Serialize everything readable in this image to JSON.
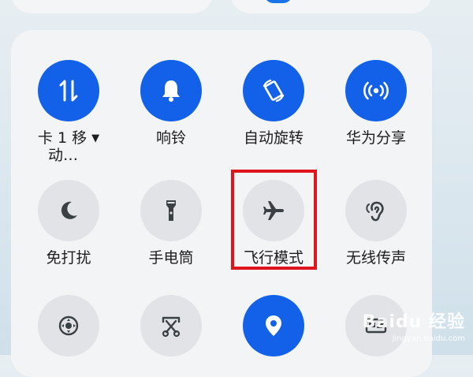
{
  "tiles": [
    {
      "id": "data",
      "label": "卡 1 移",
      "label2": "动…",
      "caret": "▼",
      "state": "on",
      "icon": "data-transfer-icon"
    },
    {
      "id": "ring",
      "label": "响铃",
      "state": "on",
      "icon": "bell-icon"
    },
    {
      "id": "rotate",
      "label": "自动旋转",
      "state": "on",
      "icon": "auto-rotate-icon"
    },
    {
      "id": "share",
      "label": "华为分享",
      "state": "on",
      "icon": "huawei-share-icon"
    },
    {
      "id": "dnd",
      "label": "免打扰",
      "state": "off",
      "icon": "moon-icon"
    },
    {
      "id": "flashlight",
      "label": "手电筒",
      "state": "off",
      "icon": "flashlight-icon"
    },
    {
      "id": "airplane",
      "label": "飞行模式",
      "state": "off",
      "icon": "airplane-icon"
    },
    {
      "id": "wireless-audio",
      "label": "无线传声",
      "state": "off",
      "icon": "ear-icon"
    },
    {
      "id": "floating-nav",
      "label": "",
      "state": "off",
      "icon": "navigation-dock-icon"
    },
    {
      "id": "screenshot",
      "label": "",
      "state": "off",
      "icon": "screenshot-scissors-icon"
    },
    {
      "id": "location",
      "label": "",
      "state": "on",
      "icon": "location-pin-icon"
    },
    {
      "id": "card",
      "label": "",
      "state": "off",
      "icon": "card-icon"
    }
  ],
  "watermark": {
    "brand": "Baidu 经验",
    "url": "jingyan.baidu.com"
  },
  "colors": {
    "active": "#1261e8",
    "inactive": "#e1e3e6",
    "highlight": "#e0141c"
  }
}
